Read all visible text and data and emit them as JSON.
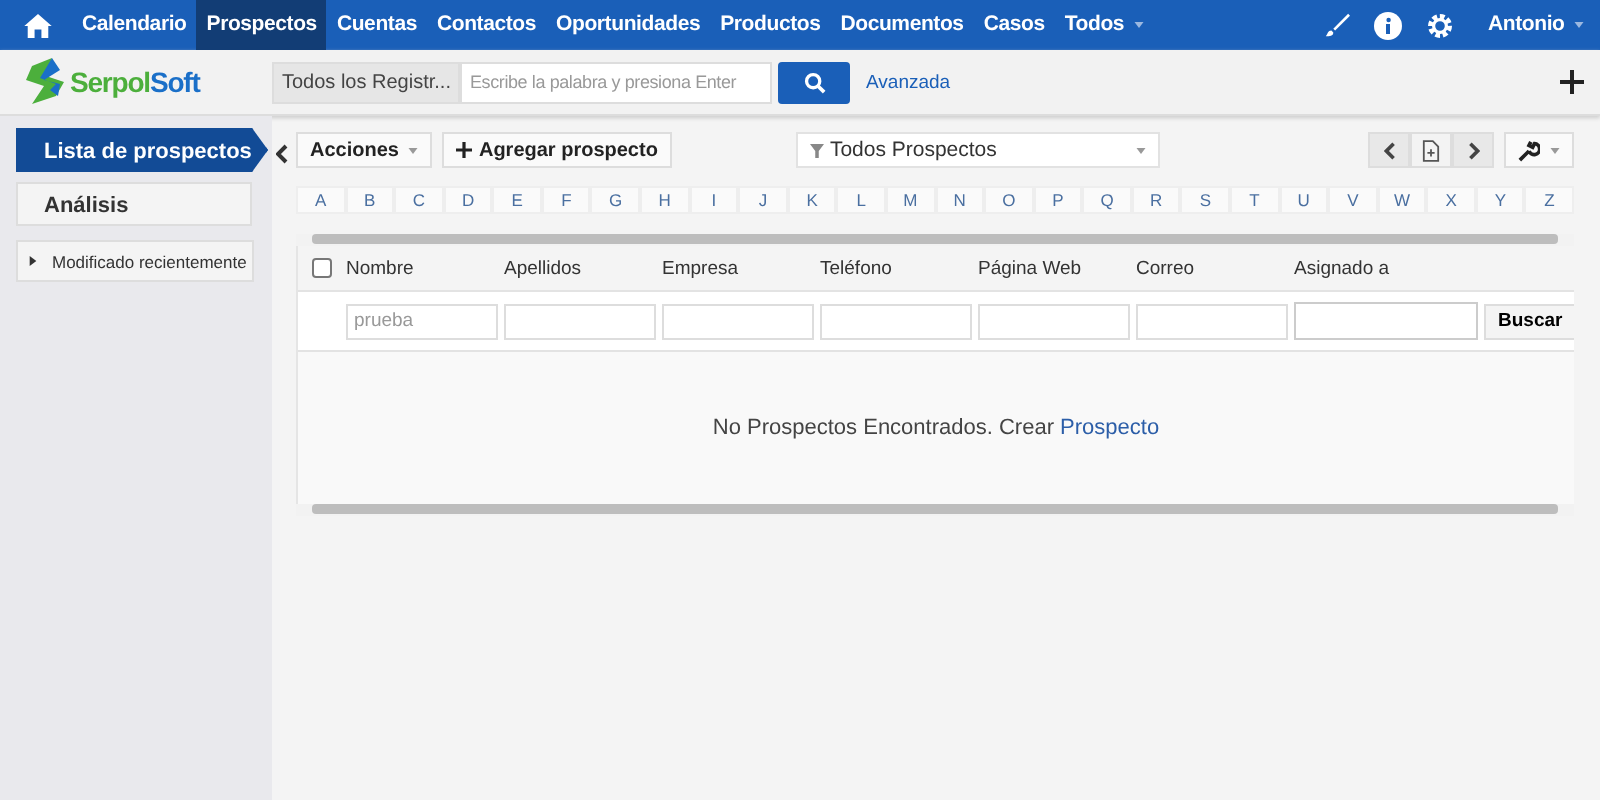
{
  "nav": {
    "items": [
      {
        "label": "Calendario",
        "selected": false
      },
      {
        "label": "Prospectos",
        "selected": true
      },
      {
        "label": "Cuentas",
        "selected": false
      },
      {
        "label": "Contactos",
        "selected": false
      },
      {
        "label": "Oportunidades",
        "selected": false
      },
      {
        "label": "Productos",
        "selected": false
      },
      {
        "label": "Documentos",
        "selected": false
      },
      {
        "label": "Casos",
        "selected": false
      }
    ],
    "more": "Todos",
    "user": "Antonio"
  },
  "header": {
    "logo": {
      "first": "Serpol",
      "second": "Soft"
    },
    "search_scope": "Todos los Registr...",
    "search": {
      "placeholder": "Escribe la palabra y presiona Enter"
    },
    "advanced": "Avanzada"
  },
  "sidebar": {
    "items": [
      {
        "label": "Lista de prospectos",
        "kind": "tab",
        "selected": true
      },
      {
        "label": "Análisis",
        "kind": "tab",
        "selected": false
      },
      {
        "label": "Modificado recientemente",
        "kind": "section",
        "expanded": false
      }
    ]
  },
  "toolbar": {
    "actions": "Acciones",
    "add": "Agregar prospecto",
    "filter": "Todos Prospectos"
  },
  "letters": [
    "A",
    "B",
    "C",
    "D",
    "E",
    "F",
    "G",
    "H",
    "I",
    "J",
    "K",
    "L",
    "M",
    "N",
    "O",
    "P",
    "Q",
    "R",
    "S",
    "T",
    "U",
    "V",
    "W",
    "X",
    "Y",
    "Z"
  ],
  "table": {
    "select_all": {
      "checked": false
    },
    "columns": [
      "Nombre",
      "Apellidos",
      "Empresa",
      "Teléfono",
      "Página Web",
      "Correo",
      "Asignado a"
    ],
    "filters": [
      {
        "placeholder": "prueba"
      }
    ],
    "search_button": "Buscar",
    "empty": {
      "text": "No Prospectos Encontrados. Crear ",
      "link": "Prospecto"
    }
  }
}
